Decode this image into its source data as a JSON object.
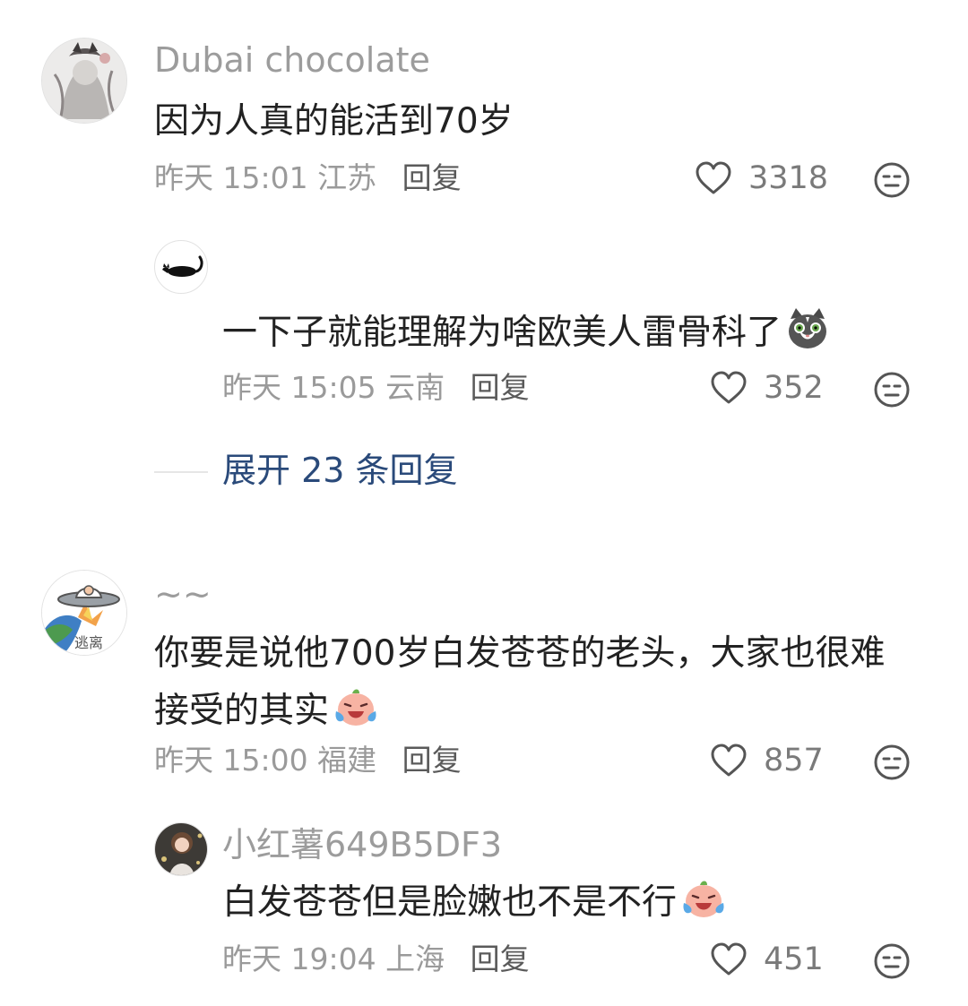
{
  "comments": [
    {
      "user": "Dubai chocolate",
      "text": "因为人真的能活到70岁",
      "date": "昨天",
      "time": "15:01",
      "location": "江苏",
      "reply_label": "回复",
      "likes": "3318",
      "replies": [
        {
          "user": "",
          "text": "一下子就能理解为啥欧美人雷骨科了",
          "emoji": "cat-face-emoji",
          "date": "昨天",
          "time": "15:05",
          "location": "云南",
          "reply_label": "回复",
          "likes": "352"
        }
      ],
      "expand_label": "展开 23 条回复"
    },
    {
      "user": "~~",
      "text_line1": "你要是说他700岁白发苍苍的老头，大家也很难",
      "text_line2": "接受的其实",
      "emoji": "crying-laughing-emoji",
      "date": "昨天",
      "time": "15:00",
      "location": "福建",
      "reply_label": "回复",
      "likes": "857",
      "replies": [
        {
          "user": "小红薯649B5DF3",
          "text": "白发苍苍但是脸嫩也不是不行",
          "emoji": "crying-laughing-emoji",
          "date": "昨天",
          "time": "19:04",
          "location": "上海",
          "reply_label": "回复",
          "likes": "451"
        }
      ]
    }
  ],
  "colors": {
    "username": "#9c9c9c",
    "text": "#222222",
    "meta": "#9a9a9a",
    "expand": "#2a4a7a"
  }
}
